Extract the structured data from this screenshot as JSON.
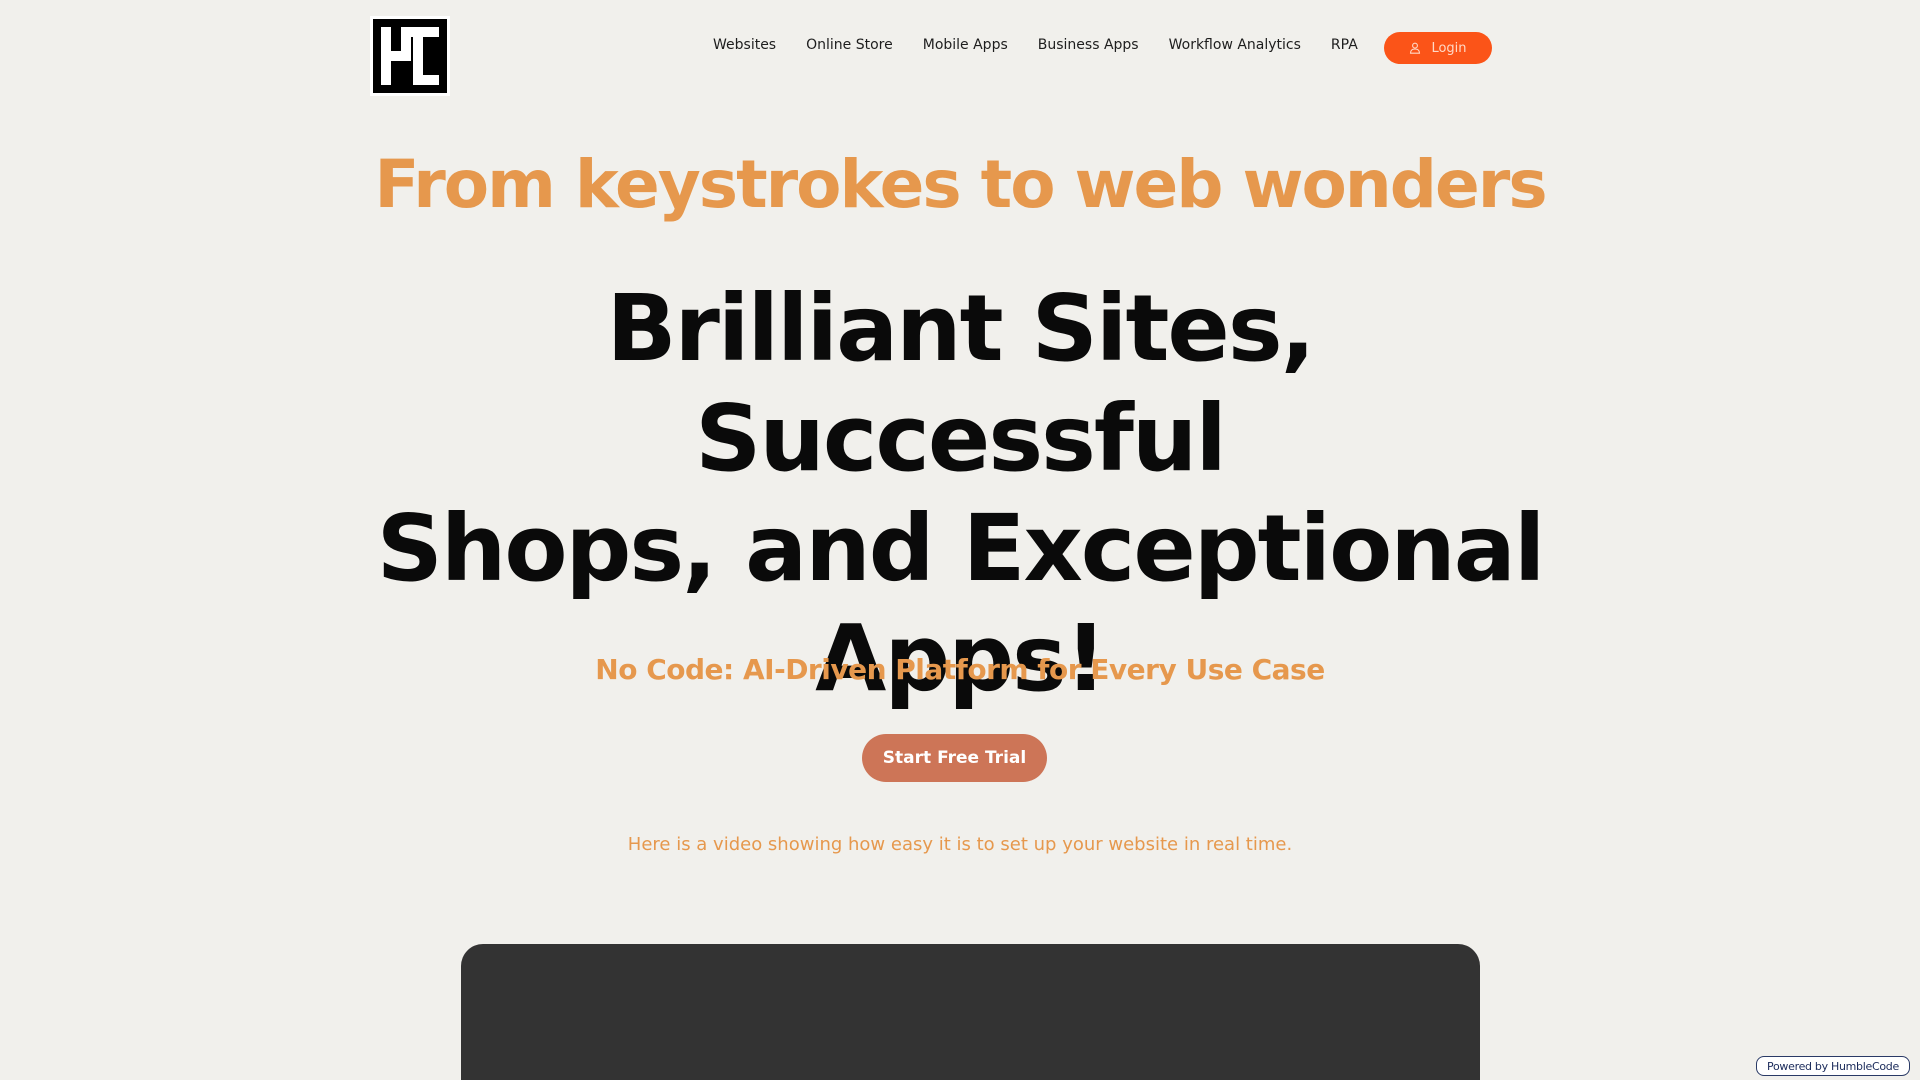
{
  "header": {
    "logo_text": "HC",
    "nav": [
      {
        "label": "Websites"
      },
      {
        "label": "Online Store"
      },
      {
        "label": "Mobile Apps"
      },
      {
        "label": "Business Apps"
      },
      {
        "label": "Workflow Analytics"
      },
      {
        "label": "RPA"
      }
    ],
    "login_label": "Login",
    "login_icon": "user-icon"
  },
  "hero": {
    "tagline": "From keystrokes to web wonders",
    "headline_line1": "Brilliant Sites, Successful",
    "headline_line2": "Shops, and Exceptional",
    "headline_line3": "Apps!",
    "subheadline": "No Code: AI-Driven Platform for Every Use Case",
    "cta_label": "Start Free Trial",
    "video_caption": "Here is a video showing how easy it is to set up your website in real time."
  },
  "footer_badge": {
    "label": "Powered by HumbleCode"
  },
  "colors": {
    "background": "#f1f0ec",
    "accent_orange": "#e6984d",
    "login_button": "#fb5418",
    "cta_button": "#cd7557",
    "headline": "#0a0a0a",
    "video_frame": "#333333"
  }
}
